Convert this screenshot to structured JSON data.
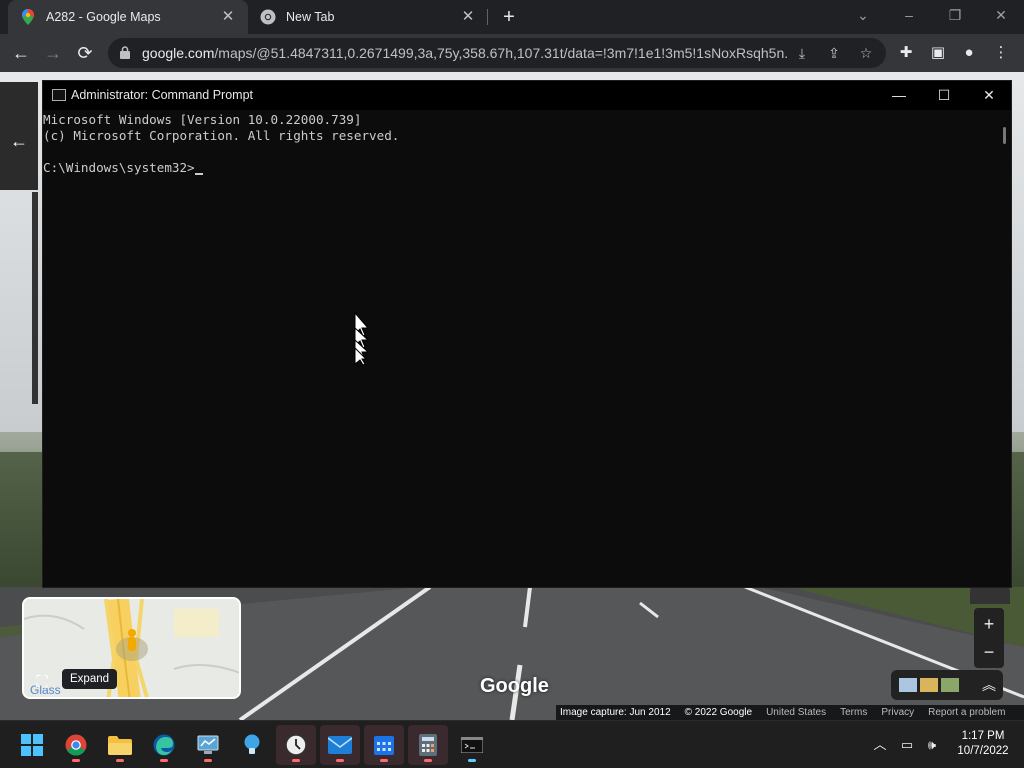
{
  "browser": {
    "tabs": [
      {
        "title": "A282 - Google Maps",
        "close": "✕"
      },
      {
        "title": "New Tab",
        "close": "✕"
      }
    ],
    "new_tab": "+",
    "url_host": "google.com",
    "url_path": "/maps/@51.4847311,0.2671499,3a,75y,358.67h,107.31t/data=!3m7!1e1!3m5!1sNoxRsqh5n...",
    "window_controls": {
      "minimize": "–",
      "maximize": "❐",
      "close": "✕"
    }
  },
  "maps": {
    "expand_tooltip": "Expand",
    "minimap_label": "Glass",
    "google_logo": "Google",
    "attribution": {
      "capture": "Image capture: Jun 2012",
      "copyright": "© 2022 Google",
      "country": "United States",
      "terms": "Terms",
      "privacy": "Privacy",
      "report": "Report a problem"
    },
    "zoom_in": "+",
    "zoom_out": "−"
  },
  "cmd": {
    "title": "Administrator: Command Prompt",
    "lines": [
      "Microsoft Windows [Version 10.0.22000.739]",
      "(c) Microsoft Corporation. All rights reserved.",
      "",
      "C:\\Windows\\system32>"
    ],
    "controls": {
      "minimize": "—",
      "maximize": "☐",
      "close": "✕"
    }
  },
  "taskbar": {
    "apps": [
      "start",
      "chrome",
      "file-explorer",
      "edge",
      "control-panel",
      "tips",
      "clock",
      "mail",
      "calendar",
      "calculator",
      "command-prompt"
    ],
    "clock_time": "1:17 PM",
    "clock_date": "10/7/2022"
  }
}
